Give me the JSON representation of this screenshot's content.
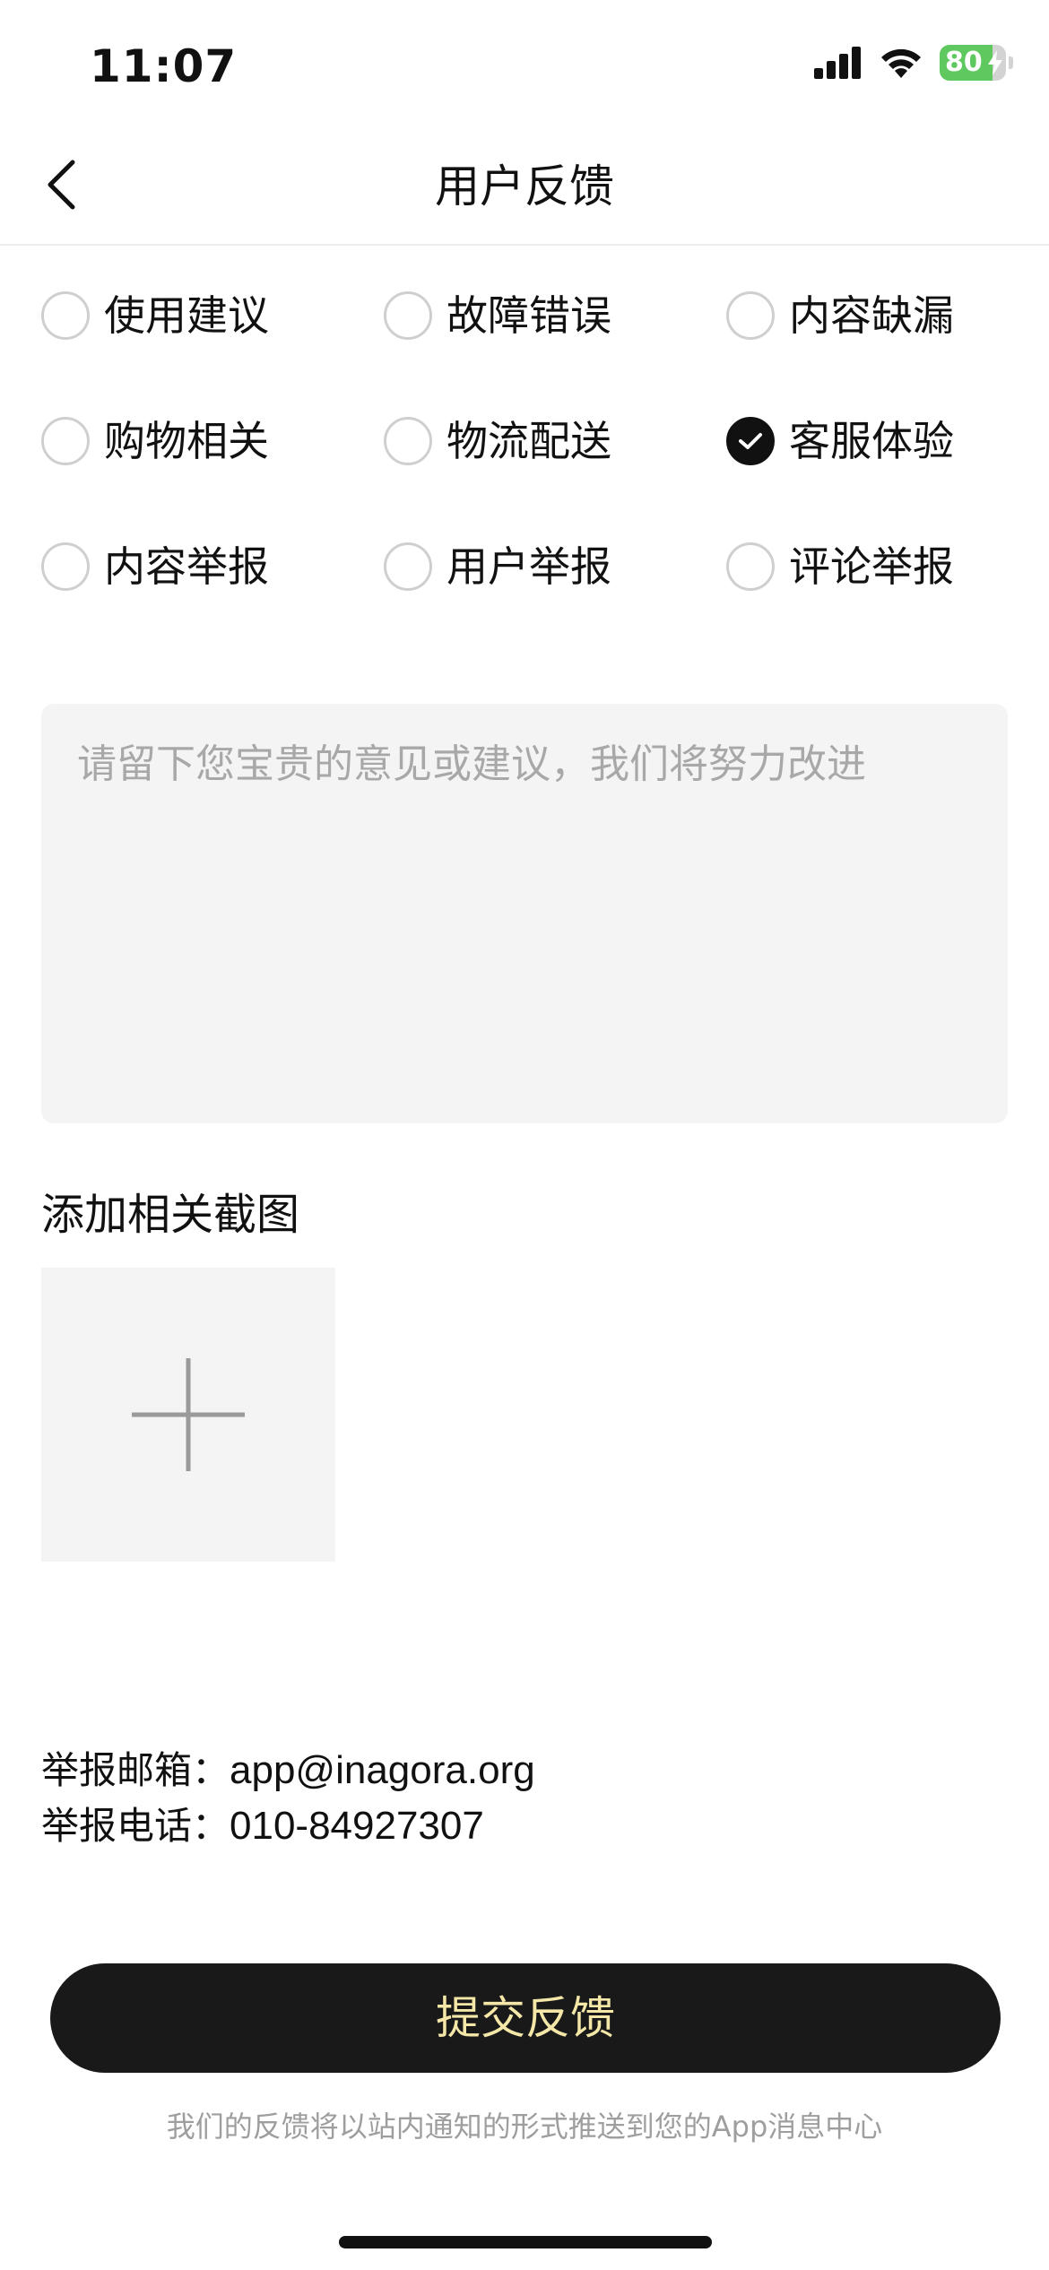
{
  "status_bar": {
    "time": "11:07",
    "battery_percent": "80",
    "battery_level": 0.8,
    "battery_charging": true,
    "signal_icon": "signal-bars-icon",
    "wifi_icon": "wifi-icon"
  },
  "nav": {
    "back_icon": "chevron-left-icon",
    "title": "用户反馈"
  },
  "categories": [
    {
      "label": "使用建议",
      "checked": false
    },
    {
      "label": "故障错误",
      "checked": false
    },
    {
      "label": "内容缺漏",
      "checked": false
    },
    {
      "label": "购物相关",
      "checked": false
    },
    {
      "label": "物流配送",
      "checked": false
    },
    {
      "label": "客服体验",
      "checked": true
    },
    {
      "label": "内容举报",
      "checked": false
    },
    {
      "label": "用户举报",
      "checked": false
    },
    {
      "label": "评论举报",
      "checked": false
    }
  ],
  "feedback": {
    "value": "",
    "placeholder": "请留下您宝贵的意见或建议，我们将努力改进"
  },
  "screenshots": {
    "label": "添加相关截图",
    "add_icon": "plus-icon"
  },
  "contact": {
    "email_label": "举报邮箱：",
    "email_value": "app@inagora.org",
    "phone_label": "举报电话：",
    "phone_value": "010-84927307"
  },
  "submit": {
    "label": "提交反馈"
  },
  "footer_note": "我们的反馈将以站内通知的形式推送到您的App消息中心",
  "colors": {
    "accent_text": "#f4e7a8",
    "button_bg": "#191919",
    "battery_green": "#5fc85f"
  }
}
